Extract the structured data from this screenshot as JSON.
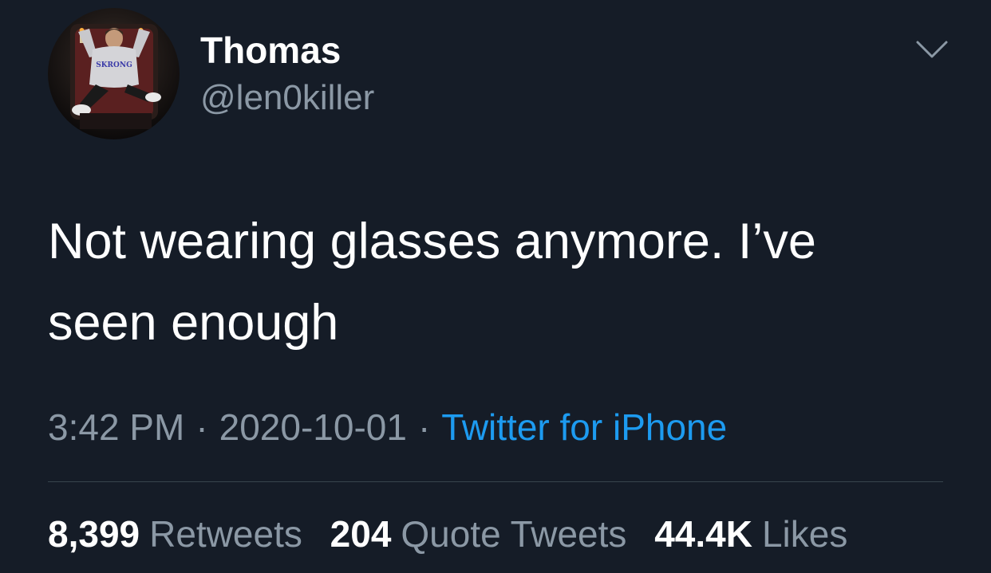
{
  "author": {
    "display_name": "Thomas",
    "handle": "@len0killer"
  },
  "tweet": {
    "text": "Not wearing glasses anymore. I’ve seen enough"
  },
  "meta": {
    "time": "3:42 PM",
    "date": "2020-10-01",
    "separator": "·",
    "source": "Twitter for iPhone"
  },
  "stats": {
    "retweets_count": "8,399",
    "retweets_label": "Retweets",
    "quotes_count": "204",
    "quotes_label": "Quote Tweets",
    "likes_count": "44.4K",
    "likes_label": "Likes"
  },
  "avatar": {
    "shirt_text": "SKRONG"
  },
  "icons": {
    "menu": "chevron-down-icon"
  },
  "colors": {
    "background": "#151c27",
    "primary_text": "#ffffff",
    "secondary_text": "#8b98a5",
    "link": "#1d9bf0",
    "divider": "#38444d"
  }
}
